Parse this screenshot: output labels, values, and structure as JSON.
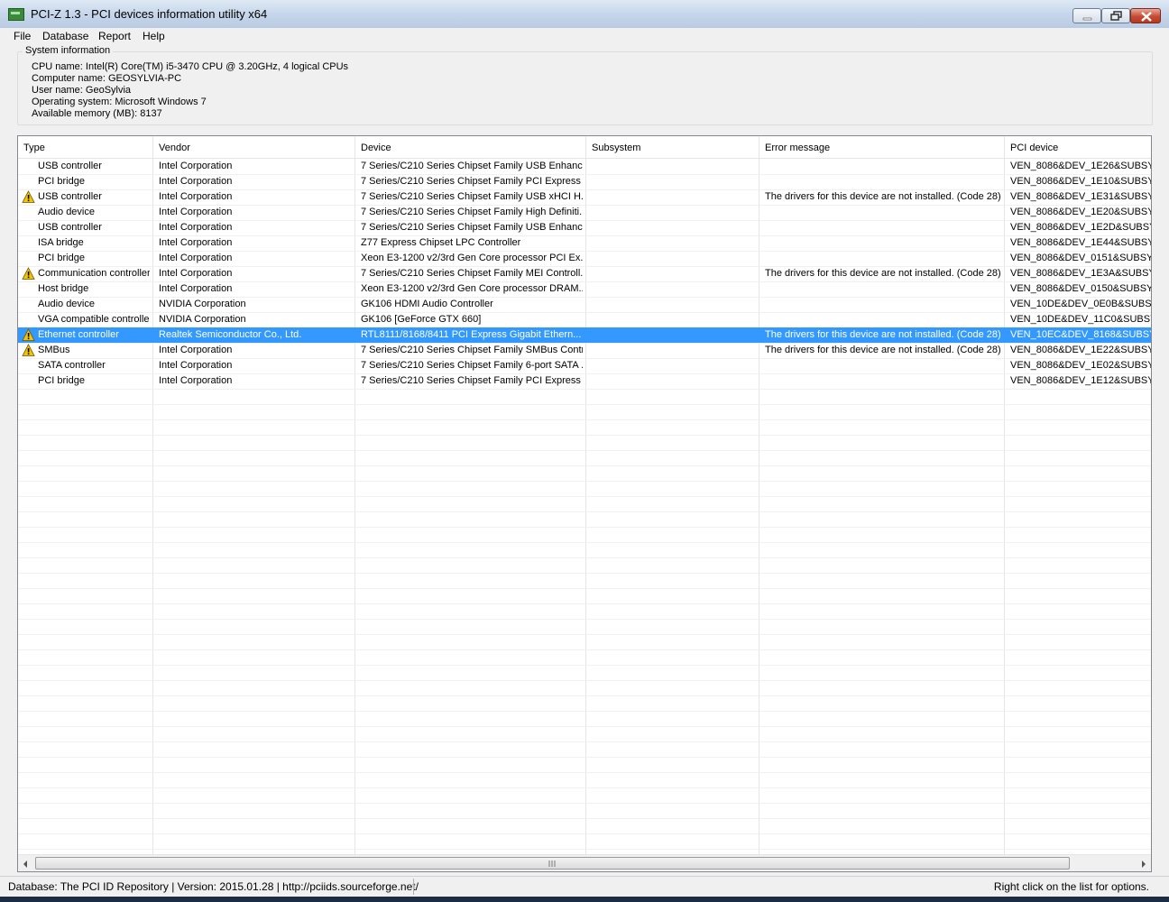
{
  "window": {
    "title": "PCI-Z 1.3 - PCI devices information utility x64"
  },
  "menu": [
    "File",
    "Database",
    "Report",
    "Help"
  ],
  "system_info": {
    "legend": "System information",
    "lines": [
      "CPU name: Intel(R) Core(TM) i5-3470 CPU @ 3.20GHz, 4 logical CPUs",
      "Computer name: GEOSYLVIA-PC",
      "User name: GeoSylvia",
      "Operating system: Microsoft Windows 7",
      "Available memory (MB): 8137"
    ]
  },
  "table": {
    "columns": [
      "Type",
      "Vendor",
      "Device",
      "Subsystem",
      "Error message",
      "PCI device"
    ],
    "rows": [
      {
        "type": "USB controller",
        "vendor": "Intel Corporation",
        "device": "7 Series/C210 Series Chipset Family USB Enhanc...",
        "subsystem": "",
        "error": "",
        "pci": "VEN_8086&DEV_1E26&SUBSYS",
        "warning": false,
        "selected": false
      },
      {
        "type": "PCI bridge",
        "vendor": "Intel Corporation",
        "device": "7 Series/C210 Series Chipset Family PCI Express ...",
        "subsystem": "",
        "error": "",
        "pci": "VEN_8086&DEV_1E10&SUBSYS",
        "warning": false,
        "selected": false
      },
      {
        "type": "USB controller",
        "vendor": "Intel Corporation",
        "device": "7 Series/C210 Series Chipset Family USB xHCI H...",
        "subsystem": "",
        "error": "The drivers for this device are not installed. (Code 28)",
        "pci": "VEN_8086&DEV_1E31&SUBSYS",
        "warning": true,
        "selected": false
      },
      {
        "type": "Audio device",
        "vendor": "Intel Corporation",
        "device": "7 Series/C210 Series Chipset Family High Definiti...",
        "subsystem": "",
        "error": "",
        "pci": "VEN_8086&DEV_1E20&SUBSYS",
        "warning": false,
        "selected": false
      },
      {
        "type": "USB controller",
        "vendor": "Intel Corporation",
        "device": "7 Series/C210 Series Chipset Family USB Enhanc...",
        "subsystem": "",
        "error": "",
        "pci": "VEN_8086&DEV_1E2D&SUBSYS",
        "warning": false,
        "selected": false
      },
      {
        "type": "ISA bridge",
        "vendor": "Intel Corporation",
        "device": "Z77 Express Chipset LPC Controller",
        "subsystem": "",
        "error": "",
        "pci": "VEN_8086&DEV_1E44&SUBSYS",
        "warning": false,
        "selected": false
      },
      {
        "type": "PCI bridge",
        "vendor": "Intel Corporation",
        "device": "Xeon E3-1200 v2/3rd Gen Core processor PCI Ex...",
        "subsystem": "",
        "error": "",
        "pci": "VEN_8086&DEV_0151&SUBSYS",
        "warning": false,
        "selected": false
      },
      {
        "type": "Communication controller",
        "vendor": "Intel Corporation",
        "device": "7 Series/C210 Series Chipset Family MEI Controll...",
        "subsystem": "",
        "error": "The drivers for this device are not installed. (Code 28)",
        "pci": "VEN_8086&DEV_1E3A&SUBSYS",
        "warning": true,
        "selected": false
      },
      {
        "type": "Host bridge",
        "vendor": "Intel Corporation",
        "device": "Xeon E3-1200 v2/3rd Gen Core processor DRAM...",
        "subsystem": "",
        "error": "",
        "pci": "VEN_8086&DEV_0150&SUBSYS",
        "warning": false,
        "selected": false
      },
      {
        "type": "Audio device",
        "vendor": "NVIDIA Corporation",
        "device": "GK106 HDMI Audio Controller",
        "subsystem": "",
        "error": "",
        "pci": "VEN_10DE&DEV_0E0B&SUBSY",
        "warning": false,
        "selected": false
      },
      {
        "type": "VGA compatible controller",
        "vendor": "NVIDIA Corporation",
        "device": "GK106 [GeForce GTX 660]",
        "subsystem": "",
        "error": "",
        "pci": "VEN_10DE&DEV_11C0&SUBSY",
        "warning": false,
        "selected": false
      },
      {
        "type": "Ethernet controller",
        "vendor": "Realtek Semiconductor Co., Ltd.",
        "device": "RTL8111/8168/8411 PCI Express Gigabit Ethern...",
        "subsystem": "",
        "error": "The drivers for this device are not installed. (Code 28)",
        "pci": "VEN_10EC&DEV_8168&SUBSYS",
        "warning": true,
        "selected": true
      },
      {
        "type": "SMBus",
        "vendor": "Intel Corporation",
        "device": "7 Series/C210 Series Chipset Family SMBus Contr...",
        "subsystem": "",
        "error": "The drivers for this device are not installed. (Code 28)",
        "pci": "VEN_8086&DEV_1E22&SUBSYS",
        "warning": true,
        "selected": false
      },
      {
        "type": "SATA controller",
        "vendor": "Intel Corporation",
        "device": "7 Series/C210 Series Chipset Family 6-port SATA ...",
        "subsystem": "",
        "error": "",
        "pci": "VEN_8086&DEV_1E02&SUBSYS",
        "warning": false,
        "selected": false
      },
      {
        "type": "PCI bridge",
        "vendor": "Intel Corporation",
        "device": "7 Series/C210 Series Chipset Family PCI Express ...",
        "subsystem": "",
        "error": "",
        "pci": "VEN_8086&DEV_1E12&SUBSYS",
        "warning": false,
        "selected": false
      }
    ]
  },
  "status": {
    "left": "Database: The PCI ID Repository | Version: 2015.01.28 | http://pciids.sourceforge.net/",
    "right": "Right click on the list for options."
  },
  "colors": {
    "selection": "#3399ff",
    "warning": "#f5c400"
  }
}
